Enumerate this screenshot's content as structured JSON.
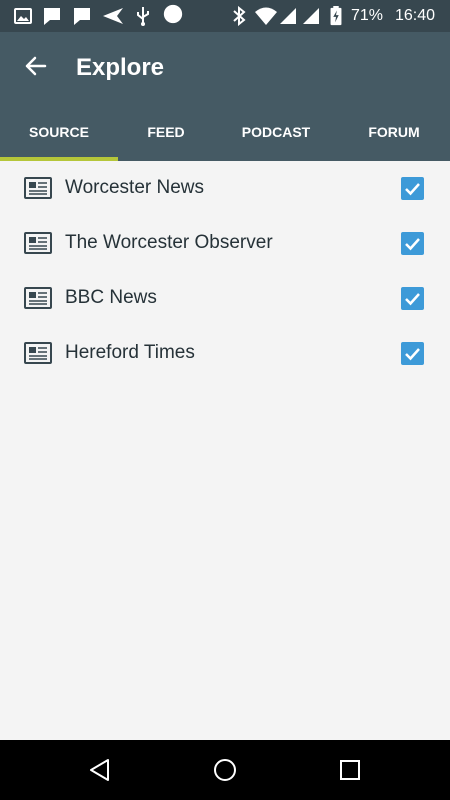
{
  "status_bar": {
    "battery": "71%",
    "time": "16:40",
    "icons": [
      "image-icon",
      "message-icon",
      "message-icon",
      "send-icon",
      "usb-icon",
      "circle-icon",
      "bluetooth-icon",
      "wifi-icon",
      "signal-icon",
      "signal-icon",
      "battery-charging-icon"
    ]
  },
  "app_bar": {
    "title": "Explore",
    "back_icon": "arrow-back-icon"
  },
  "tabs": [
    {
      "label": "SOURCE",
      "selected": true
    },
    {
      "label": "FEED",
      "selected": false
    },
    {
      "label": "PODCAST",
      "selected": false
    },
    {
      "label": "FORUM",
      "selected": false
    }
  ],
  "sources": [
    {
      "name": "Worcester News",
      "checked": true,
      "icon": "newspaper-icon"
    },
    {
      "name": "The Worcester Observer",
      "checked": true,
      "icon": "newspaper-icon"
    },
    {
      "name": "BBC News",
      "checked": true,
      "icon": "newspaper-icon"
    },
    {
      "name": "Hereford Times",
      "checked": true,
      "icon": "newspaper-icon"
    }
  ],
  "nav_bar": {
    "buttons": [
      "back-nav-icon",
      "home-nav-icon",
      "recents-nav-icon"
    ]
  },
  "colors": {
    "status_bar": "#37474f",
    "app_bar": "#455a64",
    "tab_indicator": "#b5c63a",
    "checkbox": "#3d9ad8",
    "background": "#f4f4f4"
  }
}
